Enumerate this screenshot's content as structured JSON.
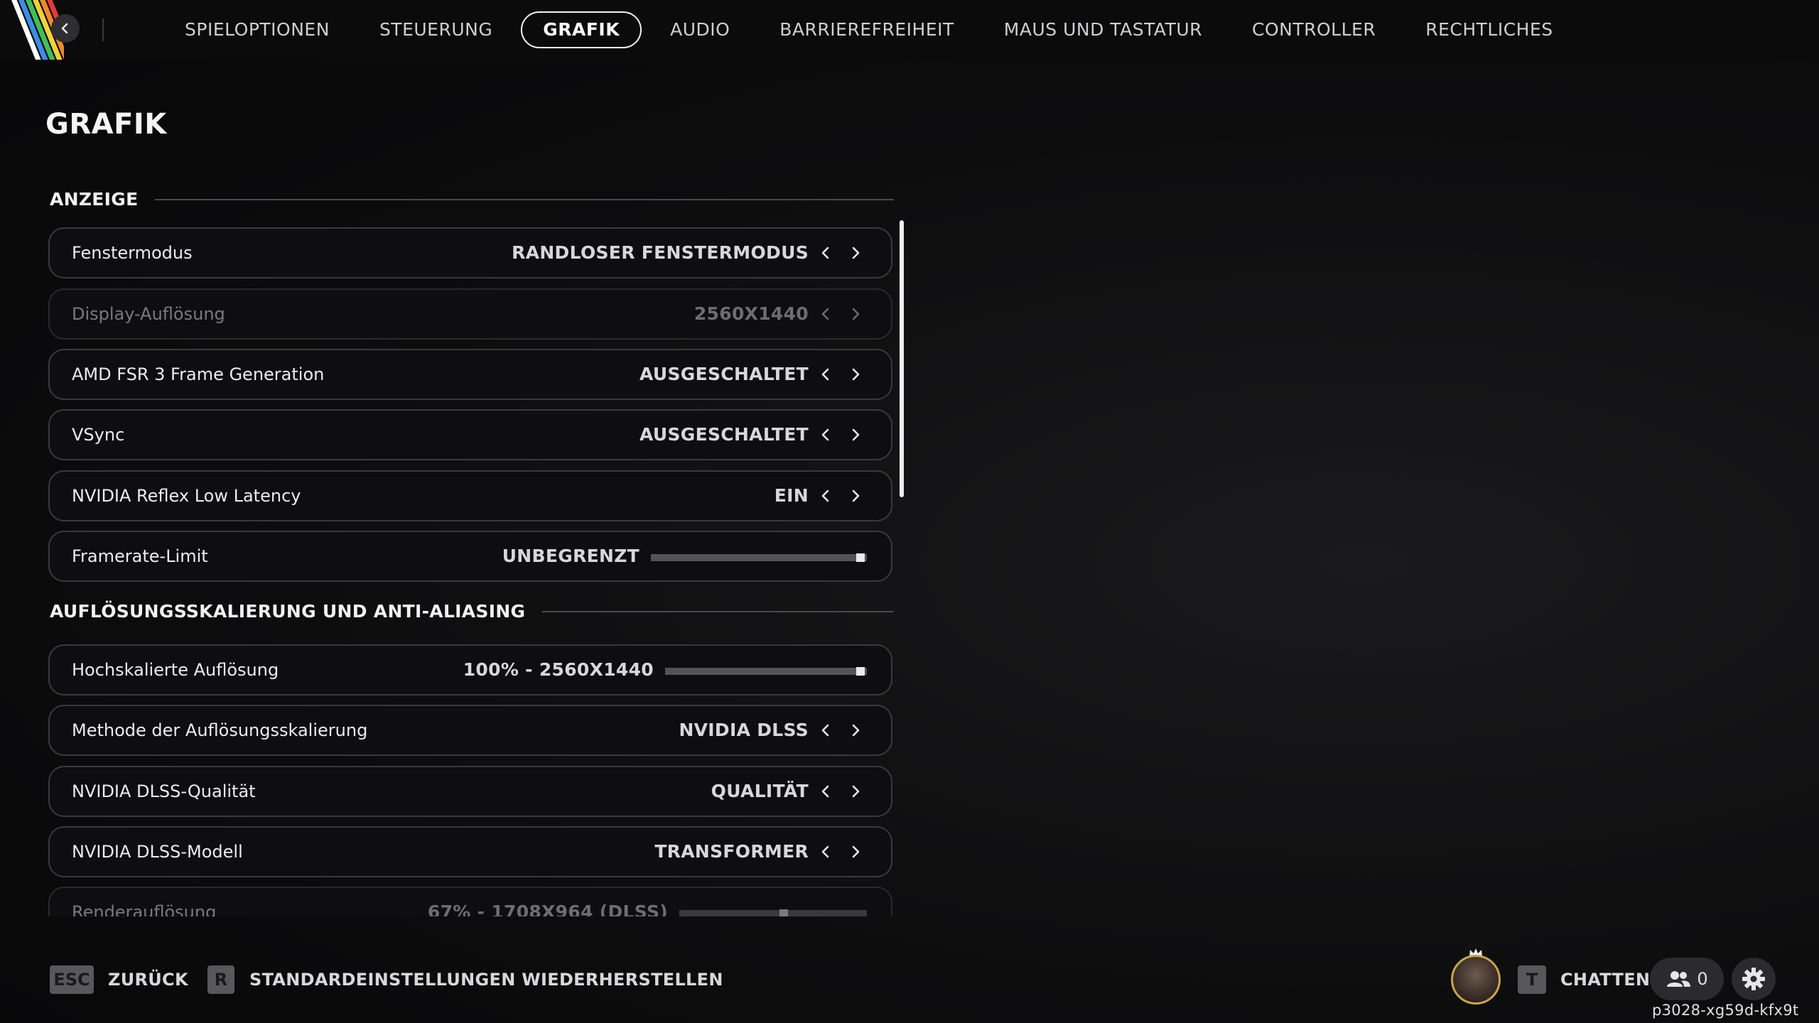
{
  "nav": {
    "tabs": [
      {
        "label": "SPIELOPTIONEN",
        "active": false
      },
      {
        "label": "STEUERUNG",
        "active": false
      },
      {
        "label": "GRAFIK",
        "active": true
      },
      {
        "label": "AUDIO",
        "active": false
      },
      {
        "label": "BARRIEREFREIHEIT",
        "active": false
      },
      {
        "label": "MAUS UND TASTATUR",
        "active": false
      },
      {
        "label": "CONTROLLER",
        "active": false
      },
      {
        "label": "RECHTLICHES",
        "active": false
      }
    ]
  },
  "page": {
    "title": "GRAFIK"
  },
  "sections": {
    "display": {
      "title": "ANZEIGE",
      "rows": [
        {
          "label": "Fenstermodus",
          "value": "RANDLOSER FENSTERMODUS",
          "type": "selector",
          "enabled": true
        },
        {
          "label": "Display-Auflösung",
          "value": "2560X1440",
          "type": "selector",
          "enabled": false
        },
        {
          "label": "AMD FSR 3 Frame Generation",
          "value": "AUSGESCHALTET",
          "type": "selector",
          "enabled": true
        },
        {
          "label": "VSync",
          "value": "AUSGESCHALTET",
          "type": "selector",
          "enabled": true
        },
        {
          "label": "NVIDIA Reflex Low Latency",
          "value": "EIN",
          "type": "selector",
          "enabled": true
        },
        {
          "label": "Framerate-Limit",
          "value": "UNBEGRENZT",
          "type": "slider",
          "level": 1.0,
          "enabled": true
        }
      ]
    },
    "scaling": {
      "title": "AUFLÖSUNGSSKALIERUNG UND ANTI-ALIASING",
      "rows": [
        {
          "label": "Hochskalierte Auflösung",
          "value": "100% - 2560X1440",
          "type": "slider",
          "level": 1.0,
          "enabled": true
        },
        {
          "label": "Methode der Auflösungsskalierung",
          "value": "NVIDIA DLSS",
          "type": "selector",
          "enabled": true
        },
        {
          "label": "NVIDIA DLSS-Qualität",
          "value": "QUALITÄT",
          "type": "selector",
          "enabled": true
        },
        {
          "label": "NVIDIA DLSS-Modell",
          "value": "TRANSFORMER",
          "type": "selector",
          "enabled": true
        },
        {
          "label": "Renderauflösung",
          "value": "67% - 1708X964 (DLSS)",
          "type": "slider",
          "level": 0.56,
          "enabled": false
        }
      ]
    }
  },
  "footer": {
    "back_key": "ESC",
    "back_label": "ZURÜCK",
    "reset_key": "R",
    "reset_label": "STANDARDEINSTELLUNGEN WIEDERHERSTELLEN",
    "chat_key": "T",
    "chat_label": "CHATTEN",
    "friends_count": "0",
    "player_id": "p3028-xg59d-kfx9t"
  },
  "colors": {
    "background": "#0d0d0e",
    "row_border": "#3a3a3d",
    "accent_white": "#f2f2f2",
    "rainbow": [
      "#e23a3a",
      "#f08a2a",
      "#f2d23a",
      "#3fbf5a",
      "#3a8ee6",
      "#ffffff"
    ]
  },
  "icons": {
    "back": "chevron-left-icon",
    "prev": "chevron-left-icon",
    "next": "chevron-right-icon",
    "friends": "friends-icon",
    "settings": "gear-icon",
    "crown": "crown-icon"
  }
}
